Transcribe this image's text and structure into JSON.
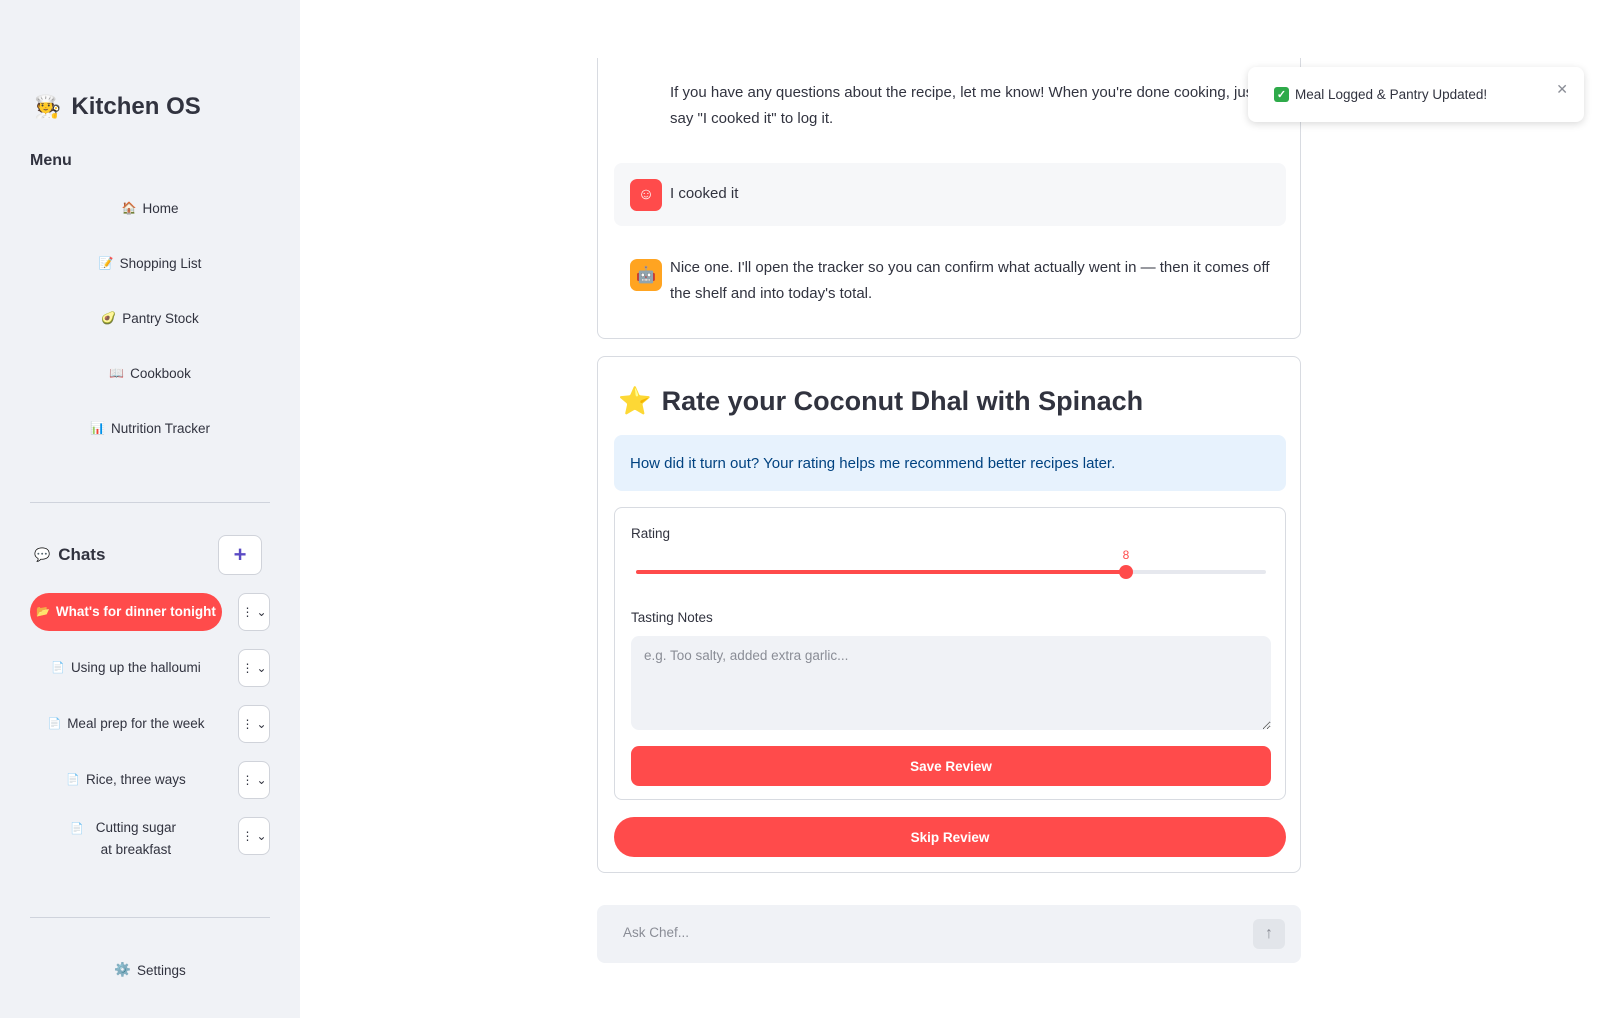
{
  "app": {
    "title": "Kitchen OS",
    "title_icon": "🧑‍🍳"
  },
  "sidebar": {
    "menu_heading": "Menu",
    "nav": [
      {
        "icon": "🏠",
        "label": "Home"
      },
      {
        "icon": "📝",
        "label": "Shopping List"
      },
      {
        "icon": "🥑",
        "label": "Pantry Stock"
      },
      {
        "icon": "📖",
        "label": "Cookbook"
      },
      {
        "icon": "📊",
        "label": "Nutrition Tracker"
      }
    ],
    "chats_heading": "Chats",
    "chats_icon": "💬",
    "new_chat_label": "+",
    "chats": [
      {
        "icon": "📂",
        "label": "What's for dinner tonight",
        "active": true
      },
      {
        "icon": "📄",
        "label": "Using up the halloumi"
      },
      {
        "icon": "📄",
        "label": "Meal prep for the week"
      },
      {
        "icon": "📄",
        "label": "Rice, three ways"
      },
      {
        "icon": "📄",
        "label": "Cutting sugar at breakfast"
      }
    ],
    "chat_menu_label": "⋮",
    "settings": {
      "icon": "⚙️",
      "label": "Settings"
    }
  },
  "conversation": {
    "assistant_prev_text": "If you have any questions about the recipe, let me know! When you're done cooking, just say \"I cooked it\" to log it.",
    "user_text": "I cooked it",
    "assistant_text": "Nice one. I'll open the tracker so you can confirm what actually went in — then it comes off the shelf and into today's total."
  },
  "rating": {
    "title": "Rate your Coconut Dhal with Spinach",
    "title_icon": "⭐",
    "info": "How did it turn out? Your rating helps me recommend better recipes later.",
    "rating_label": "Rating",
    "rating_value": 8,
    "rating_min": 1,
    "rating_max": 10,
    "notes_label": "Tasting Notes",
    "notes_placeholder": "e.g. Too salty, added extra garlic...",
    "save_label": "Save Review",
    "skip_label": "Skip Review"
  },
  "chat_input": {
    "placeholder": "Ask Chef..."
  },
  "toast": {
    "message": "Meal Logged & Pantry Updated!"
  },
  "colors": {
    "accent": "#ff4b4b",
    "info_bg": "#e7f2fd",
    "info_text": "#004280",
    "sidebar_bg": "#f0f2f6"
  }
}
